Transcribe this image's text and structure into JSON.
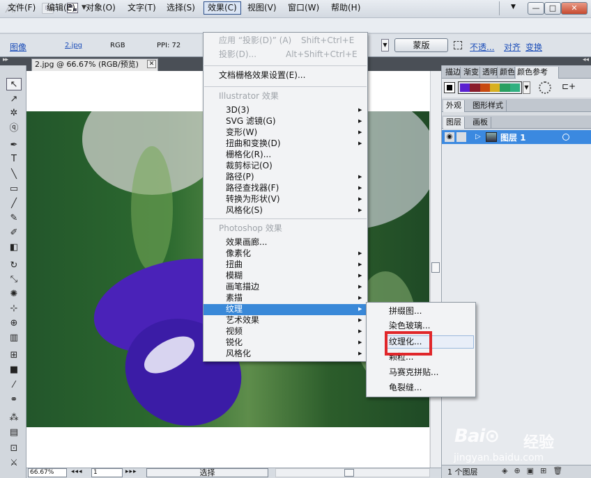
{
  "app": {
    "logo": "Ai",
    "bridge": "Br"
  },
  "menubar": [
    "文件(F)",
    "编辑(E)",
    "对象(O)",
    "文字(T)",
    "选择(S)",
    "效果(C)",
    "视图(V)",
    "窗口(W)",
    "帮助(H)"
  ],
  "window": {
    "min": "—",
    "max": "□",
    "close": "✕"
  },
  "control": {
    "image_label": "图像",
    "file": "2.jpg",
    "mode": "RGB",
    "ppi": "PPI: 72",
    "mask": "蒙版",
    "opacity": "不透...",
    "align": "对齐",
    "transform": "变换"
  },
  "document": {
    "tab_title": "2.jpg @ 66.67% (RGB/预览)",
    "close": "✕"
  },
  "status": {
    "zoom": "66.67%",
    "page": "1",
    "tool": "选择"
  },
  "effect_menu": {
    "recent_apply": {
      "label": "应用 “投影(D)” (A)",
      "shortcut": "Shift+Ctrl+E"
    },
    "recent_last": {
      "label": "投影(D)...",
      "shortcut": "Alt+Shift+Ctrl+E"
    },
    "doc_raster": "文档栅格效果设置(E)...",
    "illustrator_header": "Illustrator 效果",
    "illustrator_items": [
      "3D(3)",
      "SVG 滤镜(G)",
      "变形(W)",
      "扭曲和变换(D)",
      "栅格化(R)...",
      "裁剪标记(O)",
      "路径(P)",
      "路径查找器(F)",
      "转换为形状(V)",
      "风格化(S)"
    ],
    "photoshop_header": "Photoshop 效果",
    "photoshop_items": [
      "效果画廊...",
      "像素化",
      "扭曲",
      "模糊",
      "画笔描边",
      "素描",
      "纹理",
      "艺术效果",
      "视频",
      "锐化",
      "风格化"
    ]
  },
  "texture_submenu": [
    "拼缀图...",
    "染色玻璃...",
    "纹理化...",
    "颗粒...",
    "马赛克拼贴...",
    "龟裂缝..."
  ],
  "panels": {
    "swatch_tabs": [
      "描边",
      "渐变",
      "透明",
      "颜色",
      "颜色参考"
    ],
    "appearance_tabs": [
      "外观",
      "图形样式"
    ],
    "layer_tabs": [
      "图层",
      "画板"
    ],
    "layer_name": "图层 1",
    "layer_count": "1 个图层"
  },
  "swatch_colors": [
    "#5a20d0",
    "#8a1c2a",
    "#c84a10",
    "#d8b020",
    "#28a060",
    "#30b080"
  ],
  "colors": {
    "highlight": "#3988d8",
    "redbox": "#e0262a",
    "layer_row": "#3b89e0"
  },
  "watermark": {
    "brand": "Bai⊙",
    "cn": "经验",
    "url": "jingyan.baidu.com"
  }
}
